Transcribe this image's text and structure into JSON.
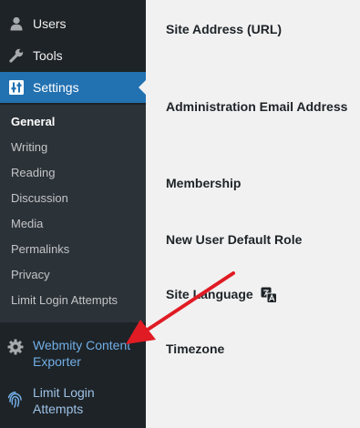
{
  "sidebar": {
    "menu": {
      "users": "Users",
      "tools": "Tools",
      "settings": "Settings"
    },
    "submenu": [
      {
        "label": "General",
        "current": true
      },
      {
        "label": "Writing"
      },
      {
        "label": "Reading"
      },
      {
        "label": "Discussion"
      },
      {
        "label": "Media"
      },
      {
        "label": "Permalinks"
      },
      {
        "label": "Privacy"
      },
      {
        "label": "Limit Login Attempts"
      }
    ],
    "plugins": {
      "webmity": {
        "line1": "Webmity Content",
        "line2": "Exporter"
      },
      "limit_login": {
        "line1": "Limit Login",
        "line2": "Attempts"
      }
    },
    "icons": {
      "users": "user-icon",
      "tools": "wrench-icon",
      "settings": "settings-sliders-icon",
      "webmity": "gear-icon",
      "limit_login": "fingerprint-icon"
    }
  },
  "content": {
    "rows": [
      "Site Address (URL)",
      "Administration Email Address",
      "Membership",
      "New User Default Role",
      "Site Language",
      "Timezone"
    ],
    "language_icon": "translation-icon"
  },
  "annotation": {
    "arrow_color": "#e01b24"
  },
  "colors": {
    "sidebar_bg": "#1d2327",
    "submenu_bg": "#2c3338",
    "accent": "#2271b1",
    "content_bg": "#f1f1f1"
  }
}
